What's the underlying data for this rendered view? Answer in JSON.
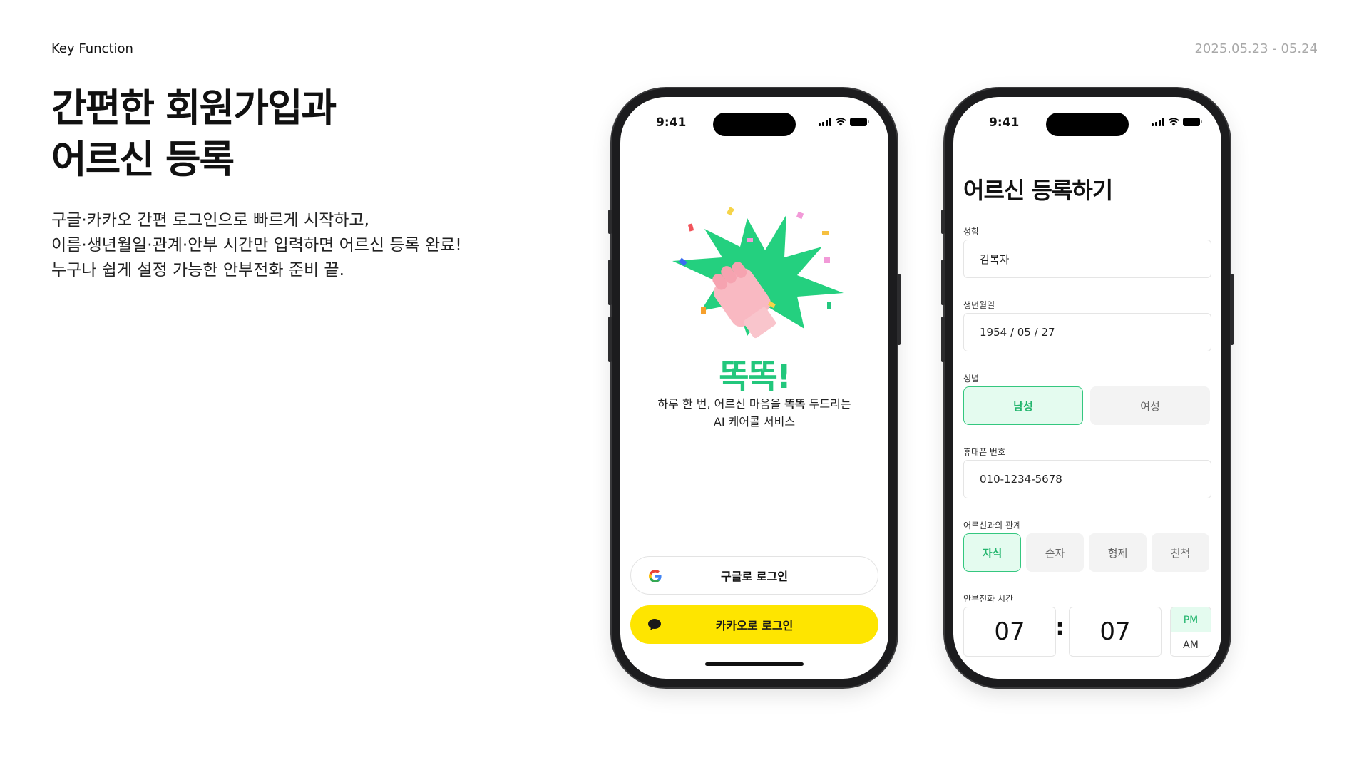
{
  "header": {
    "section_label": "Key Function",
    "date_range": "2025.05.23 - 05.24",
    "headline_line1": "간편한 회원가입과",
    "headline_line2": "어르신 등록",
    "desc_line1": "구글·카카오 간편 로그인으로 빠르게 시작하고,",
    "desc_line2": "이름·생년월일·관계·안부 시간만 입력하면 어르신 등록 완료!",
    "desc_line3": "누구나 쉽게 설정 가능한 안부전화  준비 끝."
  },
  "status_bar": {
    "time": "9:41"
  },
  "login_screen": {
    "brand": "똑똑!",
    "tagline_pre": "하루 한 번, 어르신 마음을 ",
    "tagline_bold": "똑똑",
    "tagline_post": " 두드리는",
    "tagline_line2": "AI 케어콜 서비스",
    "google_login": "구글로 로그인",
    "kakao_login": "카카오로 로그인",
    "colors": {
      "brand": "#22c77c",
      "kakao": "#fee500"
    }
  },
  "register_screen": {
    "title": "어르신 등록하기",
    "name": {
      "label": "성함",
      "value": "김복자"
    },
    "birth": {
      "label": "생년월일",
      "value": "1954 / 05 / 27"
    },
    "gender": {
      "label": "성별",
      "options": [
        "남성",
        "여성"
      ],
      "selected": "남성"
    },
    "phone": {
      "label": "휴대폰 번호",
      "value": "010-1234-5678"
    },
    "relation": {
      "label": "어르신과의 관계",
      "options": [
        "자식",
        "손자",
        "형제",
        "친척"
      ],
      "selected": "자식"
    },
    "call_time": {
      "label": "안부전화 시간",
      "hour": "07",
      "colon": ":",
      "minute": "07",
      "pm": "PM",
      "am": "AM",
      "selected_period": "PM"
    }
  }
}
